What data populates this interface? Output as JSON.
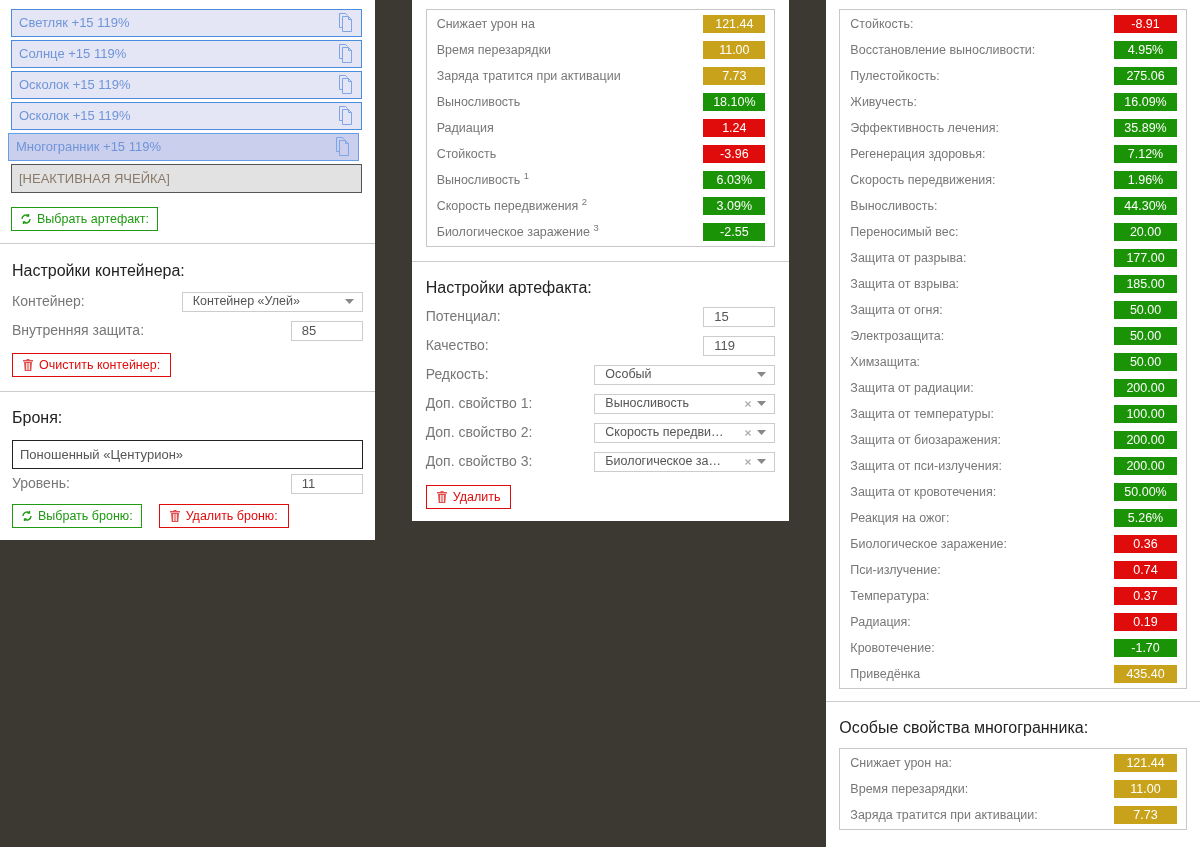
{
  "artifact_slots": [
    {
      "kind": "artifact",
      "label": "Светляк +15 119%",
      "selected": false
    },
    {
      "kind": "artifact",
      "label": "Солнце +15 119%",
      "selected": false
    },
    {
      "kind": "artifact",
      "label": "Осколок +15 119%",
      "selected": false
    },
    {
      "kind": "artifact",
      "label": "Осколок +15 119%",
      "selected": false
    },
    {
      "kind": "artifact",
      "label": "Многогранник +15 119%",
      "selected": true
    },
    {
      "kind": "inactive",
      "label": "[НЕАКТИВНАЯ ЯЧЕЙКА]"
    }
  ],
  "choose_artifact_button": "Выбрать артефакт:",
  "container_settings": {
    "title": "Настройки контейнера:",
    "fields": [
      {
        "kind": "select",
        "label": "Контейнер:",
        "value": "Контейнер «Улей»"
      },
      {
        "kind": "input",
        "label": "Внутренняя защита:",
        "value": "85"
      }
    ],
    "clear_button": "Очистить контейнер:"
  },
  "armor": {
    "title": "Броня:",
    "name": "Поношенный «Центурион»",
    "level_label": "Уровень:",
    "level_value": "11",
    "choose_button": "Выбрать броню:",
    "delete_button": "Удалить броню:"
  },
  "artifact_stats": [
    {
      "label": "Снижает урон на",
      "value": "121.44",
      "color": "#c8a21a"
    },
    {
      "label": "Время перезарядки",
      "value": "11.00",
      "color": "#c8a21a"
    },
    {
      "label": "Заряда тратится при активации",
      "value": "7.73",
      "color": "#c8a21a"
    },
    {
      "label": "Выносливость",
      "value": "18.10%",
      "color": "#1a9306"
    },
    {
      "label": "Радиация",
      "value": "1.24",
      "color": "#e00b0b"
    },
    {
      "label": "Стойкость",
      "value": "-3.96",
      "color": "#e00b0b"
    },
    {
      "label": "Выносливость $^{1}$",
      "value": "6.03%",
      "color": "#1a9306"
    },
    {
      "label": "Скорость передвижения $^{2}$",
      "value": "3.09%",
      "color": "#1a9306"
    },
    {
      "label": "Биологическое заражение $^{3}$",
      "value": "-2.55",
      "color": "#1a9306"
    }
  ],
  "artifact_settings": {
    "title": "Настройки артефакта:",
    "fields": [
      {
        "kind": "input",
        "label": "Потенциал:",
        "value": "15"
      },
      {
        "kind": "input",
        "label": "Качество:",
        "value": "119"
      },
      {
        "kind": "select",
        "label": "Редкость:",
        "value": "Особый",
        "clearable": false
      },
      {
        "kind": "select",
        "label": "Доп. свойство 1:",
        "value": "Выносливость",
        "clearable": true
      },
      {
        "kind": "select",
        "label": "Доп. свойство 2:",
        "value": "Скорость передви…",
        "clearable": true
      },
      {
        "kind": "select",
        "label": "Доп. свойство 3:",
        "value": "Биологическое за…",
        "clearable": true
      }
    ],
    "delete_button": "Удалить"
  },
  "total_stats": [
    {
      "label": "Стойкость:",
      "value": "-8.91",
      "color": "#e00b0b"
    },
    {
      "label": "Восстановление выносливости:",
      "value": "4.95%",
      "color": "#1a9306"
    },
    {
      "label": "Пулестойкость:",
      "value": "275.06",
      "color": "#1a9306"
    },
    {
      "label": "Живучесть:",
      "value": "16.09%",
      "color": "#1a9306"
    },
    {
      "label": "Эффективность лечения:",
      "value": "35.89%",
      "color": "#1a9306"
    },
    {
      "label": "Регенерация здоровья:",
      "value": "7.12%",
      "color": "#1a9306"
    },
    {
      "label": "Скорость передвижения:",
      "value": "1.96%",
      "color": "#1a9306"
    },
    {
      "label": "Выносливость:",
      "value": "44.30%",
      "color": "#1a9306"
    },
    {
      "label": "Переносимый вес:",
      "value": "20.00",
      "color": "#1a9306"
    },
    {
      "label": "Защита от разрыва:",
      "value": "177.00",
      "color": "#1a9306"
    },
    {
      "label": "Защита от взрыва:",
      "value": "185.00",
      "color": "#1a9306"
    },
    {
      "label": "Защита от огня:",
      "value": "50.00",
      "color": "#1a9306"
    },
    {
      "label": "Электрозащита:",
      "value": "50.00",
      "color": "#1a9306"
    },
    {
      "label": "Химзащита:",
      "value": "50.00",
      "color": "#1a9306"
    },
    {
      "label": "Защита от радиации:",
      "value": "200.00",
      "color": "#1a9306"
    },
    {
      "label": "Защита от температуры:",
      "value": "100.00",
      "color": "#1a9306"
    },
    {
      "label": "Защита от биозаражения:",
      "value": "200.00",
      "color": "#1a9306"
    },
    {
      "label": "Защита от пси-излучения:",
      "value": "200.00",
      "color": "#1a9306"
    },
    {
      "label": "Защита от кровотечения:",
      "value": "50.00%",
      "color": "#1a9306"
    },
    {
      "label": "Реакция на ожог:",
      "value": "5.26%",
      "color": "#1a9306"
    },
    {
      "label": "Биологическое заражение:",
      "value": "0.36",
      "color": "#e00b0b"
    },
    {
      "label": "Пси-излучение:",
      "value": "0.74",
      "color": "#e00b0b"
    },
    {
      "label": "Температура:",
      "value": "0.37",
      "color": "#e00b0b"
    },
    {
      "label": "Радиация:",
      "value": "0.19",
      "color": "#e00b0b"
    },
    {
      "label": "Кровотечение:",
      "value": "-1.70",
      "color": "#1a9306"
    },
    {
      "label": "Приведёнка",
      "value": "435.40",
      "color": "#c8a21a"
    }
  ],
  "special_properties": {
    "title": "Особые свойства многогранника:",
    "stats": [
      {
        "label": "Снижает урон на:",
        "value": "121.44",
        "color": "#c8a21a"
      },
      {
        "label": "Время перезарядки:",
        "value": "11.00",
        "color": "#c8a21a"
      },
      {
        "label": "Заряда тратится при активации:",
        "value": "7.73",
        "color": "#c8a21a"
      }
    ]
  }
}
